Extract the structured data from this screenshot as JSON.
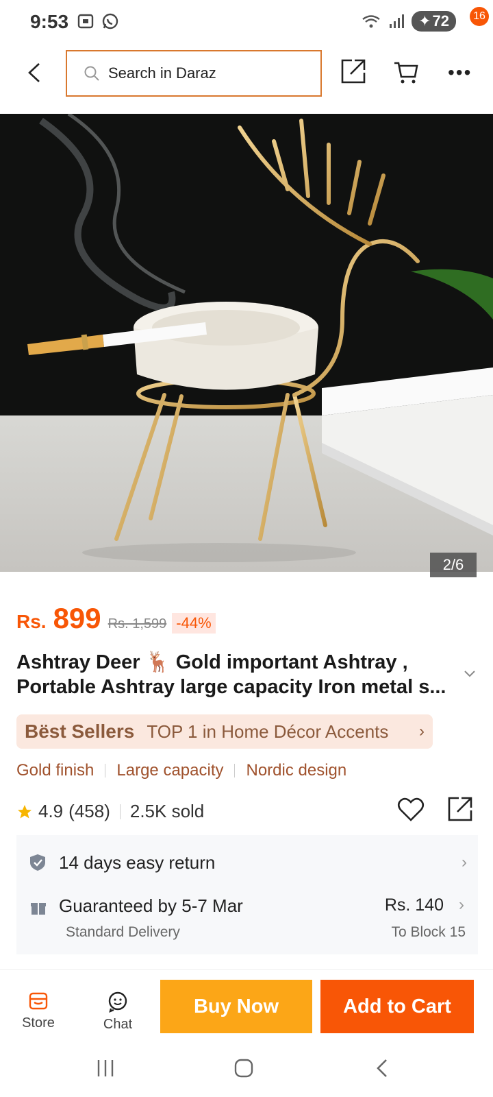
{
  "status_bar": {
    "time": "9:53",
    "battery": "72",
    "icons": [
      "screenshot-icon",
      "whatsapp-icon",
      "wifi-icon",
      "signal-icon",
      "battery-icon"
    ]
  },
  "header": {
    "search_placeholder": "Search in Daraz",
    "notification_count": "16",
    "icons": [
      "back-icon",
      "search-icon",
      "share-icon",
      "cart-icon",
      "more-icon"
    ]
  },
  "gallery": {
    "counter": "2/6",
    "image_description_icons": [
      "deer-ashtray-image"
    ]
  },
  "price": {
    "currency": "Rs.",
    "current": "899",
    "original": "Rs. 1,599",
    "discount": "-44%"
  },
  "product": {
    "title_line1": "Ashtray Deer 🦌 Gold important Ashtray ,",
    "title_line2": "Portable Ashtray large capacity Iron metal s..."
  },
  "best_seller": {
    "label": "Bëst Sellers",
    "text": "TOP 1 in Home Décor Accents"
  },
  "tags": [
    "Gold finish",
    "Large capacity",
    "Nordic design"
  ],
  "rating": {
    "score": "4.9",
    "count": "(458)",
    "sold": "2.5K sold",
    "stars_value": 4.9
  },
  "service": {
    "return_text": "14 days easy return",
    "delivery_title": "Guaranteed by 5-7 Mar",
    "delivery_type": "Standard Delivery",
    "delivery_price": "Rs. 140",
    "delivery_to": "To Block 15"
  },
  "bottom_bar": {
    "store_label": "Store",
    "chat_label": "Chat",
    "buy_now_label": "Buy Now",
    "add_to_cart_label": "Add to Cart"
  },
  "colors": {
    "accent": "#f85606",
    "buy_now": "#fca617",
    "search_border": "#d9782e",
    "best_seller_bg": "#fbe8df"
  }
}
